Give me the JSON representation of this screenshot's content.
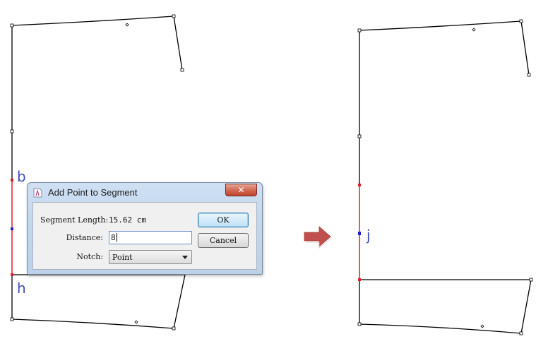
{
  "dialog": {
    "title": "Add Point to Segment",
    "close_label": "✕",
    "segment_length_label": "Segment Length:",
    "segment_length_value": "15.62 cm",
    "distance_label": "Distance:",
    "distance_value": "8",
    "notch_label": "Notch:",
    "notch_value": "Point",
    "ok_label": "OK",
    "cancel_label": "Cancel"
  },
  "point_labels": {
    "b": "b",
    "h": "h",
    "j": "j"
  },
  "colors": {
    "outline": "#000000",
    "selected_segment": "#e02020",
    "new_point": "#2020d0",
    "label": "#3d4fbf",
    "arrow": "#c0504d"
  }
}
